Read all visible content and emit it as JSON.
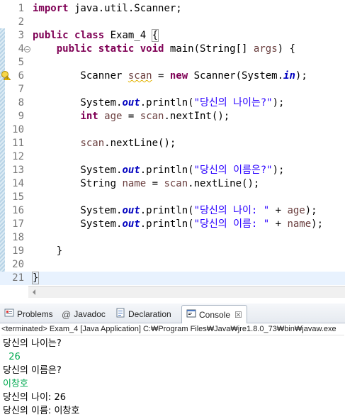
{
  "editor": {
    "lines": [
      {
        "n": "1",
        "tokens": [
          {
            "t": "import",
            "c": "kw"
          },
          {
            "t": " java.util.Scanner;"
          }
        ]
      },
      {
        "n": "2",
        "tokens": []
      },
      {
        "n": "3",
        "tokens": [
          {
            "t": "public",
            "c": "kw"
          },
          {
            "t": " "
          },
          {
            "t": "class",
            "c": "kw"
          },
          {
            "t": " Exam_4 "
          },
          {
            "t": "{",
            "c": "brace-box"
          }
        ]
      },
      {
        "n": "4",
        "fold": "−",
        "tokens": [
          {
            "t": "    "
          },
          {
            "t": "public",
            "c": "kw"
          },
          {
            "t": " "
          },
          {
            "t": "static",
            "c": "kw"
          },
          {
            "t": " "
          },
          {
            "t": "void",
            "c": "kw"
          },
          {
            "t": " main(String[] "
          },
          {
            "t": "args",
            "c": "lv"
          },
          {
            "t": ") {"
          }
        ]
      },
      {
        "n": "5",
        "tokens": []
      },
      {
        "n": "6",
        "tokens": [
          {
            "t": "        Scanner "
          },
          {
            "t": "scan",
            "c": "lv squig"
          },
          {
            "t": " = "
          },
          {
            "t": "new",
            "c": "kw"
          },
          {
            "t": " Scanner(System."
          },
          {
            "t": "in",
            "c": "fld"
          },
          {
            "t": ");"
          }
        ]
      },
      {
        "n": "7",
        "tokens": []
      },
      {
        "n": "8",
        "tokens": [
          {
            "t": "        System."
          },
          {
            "t": "out",
            "c": "fld"
          },
          {
            "t": ".println("
          },
          {
            "t": "\"당신의 나이는?\"",
            "c": "str"
          },
          {
            "t": ");"
          }
        ]
      },
      {
        "n": "9",
        "tokens": [
          {
            "t": "        "
          },
          {
            "t": "int",
            "c": "kw"
          },
          {
            "t": " "
          },
          {
            "t": "age",
            "c": "lv"
          },
          {
            "t": " = "
          },
          {
            "t": "scan",
            "c": "lv"
          },
          {
            "t": ".nextInt();"
          }
        ]
      },
      {
        "n": "10",
        "tokens": []
      },
      {
        "n": "11",
        "tokens": [
          {
            "t": "        "
          },
          {
            "t": "scan",
            "c": "lv"
          },
          {
            "t": ".nextLine();"
          }
        ]
      },
      {
        "n": "12",
        "tokens": []
      },
      {
        "n": "13",
        "tokens": [
          {
            "t": "        System."
          },
          {
            "t": "out",
            "c": "fld"
          },
          {
            "t": ".println("
          },
          {
            "t": "\"당신의 이름은?\"",
            "c": "str"
          },
          {
            "t": ");"
          }
        ]
      },
      {
        "n": "14",
        "tokens": [
          {
            "t": "        String "
          },
          {
            "t": "name",
            "c": "lv"
          },
          {
            "t": " = "
          },
          {
            "t": "scan",
            "c": "lv"
          },
          {
            "t": ".nextLine();"
          }
        ]
      },
      {
        "n": "15",
        "tokens": []
      },
      {
        "n": "16",
        "tokens": [
          {
            "t": "        System."
          },
          {
            "t": "out",
            "c": "fld"
          },
          {
            "t": ".println("
          },
          {
            "t": "\"당신의 나이: \"",
            "c": "str"
          },
          {
            "t": " + "
          },
          {
            "t": "age",
            "c": "lv"
          },
          {
            "t": ");"
          }
        ]
      },
      {
        "n": "17",
        "tokens": [
          {
            "t": "        System."
          },
          {
            "t": "out",
            "c": "fld"
          },
          {
            "t": ".println("
          },
          {
            "t": "\"당신의 이름: \"",
            "c": "str"
          },
          {
            "t": " + "
          },
          {
            "t": "name",
            "c": "lv"
          },
          {
            "t": ");"
          }
        ]
      },
      {
        "n": "18",
        "tokens": []
      },
      {
        "n": "19",
        "tokens": [
          {
            "t": "    }"
          }
        ]
      },
      {
        "n": "20",
        "tokens": []
      },
      {
        "n": "21",
        "current": true,
        "tokens": [
          {
            "t": "}",
            "c": "brace-box"
          }
        ]
      }
    ]
  },
  "views": {
    "tabs": [
      {
        "label": "Problems",
        "icon": "problems-icon"
      },
      {
        "label": "Javadoc",
        "icon": "javadoc-icon"
      },
      {
        "label": "Declaration",
        "icon": "declaration-icon"
      },
      {
        "label": "Console",
        "icon": "console-icon",
        "active": true,
        "close": "☒"
      }
    ]
  },
  "console": {
    "description": "<terminated> Exam_4 [Java Application] C:₩Program Files₩Java₩jre1.8.0_73₩bin₩javaw.exe",
    "lines": [
      {
        "text": "당신의 나이는?",
        "input": false
      },
      {
        "text": "  26",
        "input": true
      },
      {
        "text": "당신의 이름은?",
        "input": false
      },
      {
        "text": "이창호",
        "input": true
      },
      {
        "text": "당신의 나이: 26",
        "input": false
      },
      {
        "text": "당신의 이름: 이창호",
        "input": false
      }
    ]
  },
  "colors": {
    "keyword": "#7f0055",
    "field": "#0000c0",
    "local_var": "#6a3e3e",
    "string": "#2a00ff",
    "console_input": "#00a94f"
  }
}
